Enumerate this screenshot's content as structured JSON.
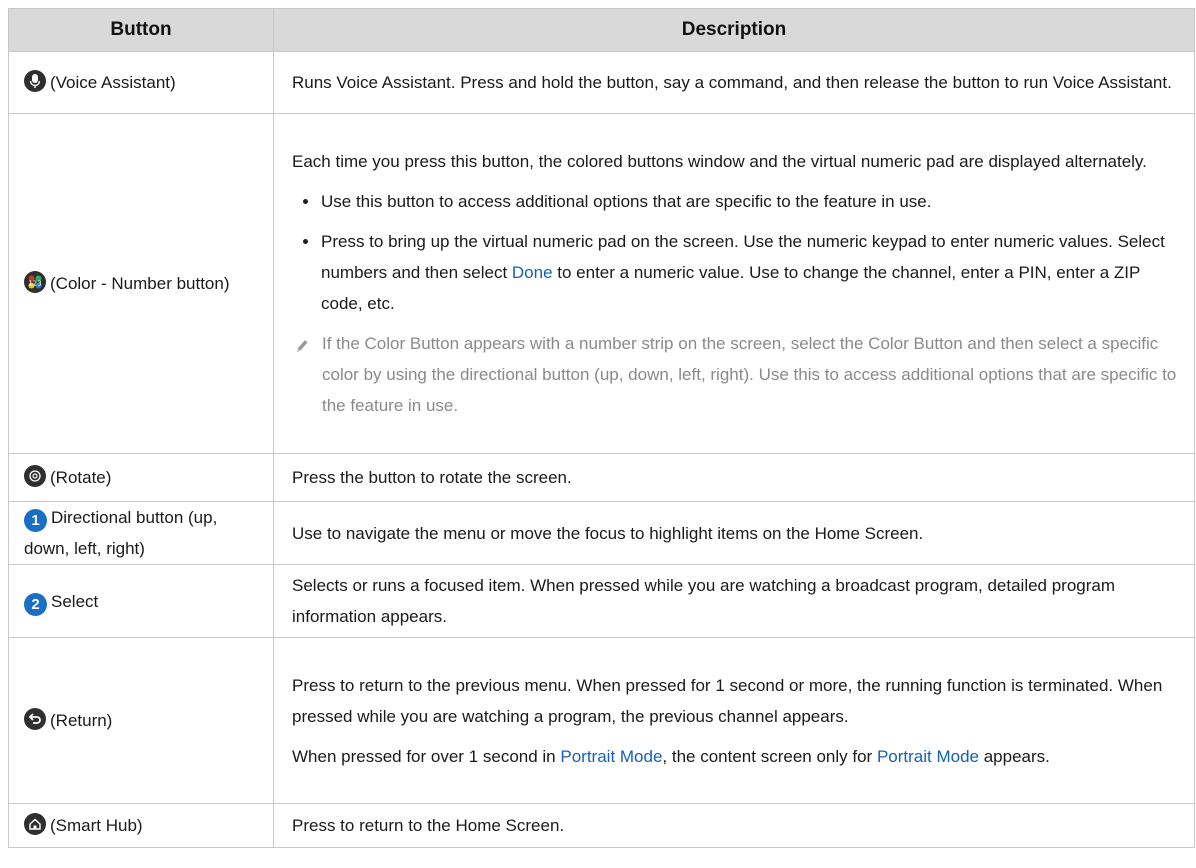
{
  "headers": {
    "button": "Button",
    "description": "Description"
  },
  "rows": {
    "voice": {
      "icon": "microphone-icon",
      "label": "(Voice Assistant)",
      "desc": "Runs Voice Assistant. Press and hold the button, say a command, and then release the button to run Voice Assistant."
    },
    "color": {
      "icon": "color-number-icon",
      "label": "(Color - Number button)",
      "intro": "Each time you press this button, the colored buttons window and the virtual numeric pad are displayed alternately.",
      "bullet1": "Use this button to access additional options that are specific to the feature in use.",
      "bullet2_a": "Press to bring up the virtual numeric pad on the screen. Use the numeric keypad to enter numeric values. Select numbers and then select ",
      "bullet2_link": "Done",
      "bullet2_b": " to enter a numeric value. Use to change the channel, enter a PIN, enter a ZIP code, etc.",
      "note": "If the Color Button appears with a number strip on the screen, select the Color Button and then select a specific color by using the directional button (up, down, left, right). Use this to access additional options that are specific to the feature in use."
    },
    "rotate": {
      "icon": "rotate-icon",
      "label": "(Rotate)",
      "desc": "Press the button to rotate the screen."
    },
    "directional": {
      "badge": "1",
      "label": "Directional button (up, down, left, right)",
      "desc": "Use to navigate the menu or move the focus to highlight items on the Home Screen."
    },
    "select": {
      "badge": "2",
      "label": "Select",
      "desc": "Selects or runs a focused item. When pressed while you are watching a broadcast program, detailed program information appears."
    },
    "return": {
      "icon": "return-icon",
      "label": "(Return)",
      "desc1": "Press to return to the previous menu. When pressed for 1 second or more, the running function is terminated. When pressed while you are watching a program, the previous channel appears.",
      "desc2_a": "When pressed for over 1 second in ",
      "desc2_link1": "Portrait Mode",
      "desc2_b": ", the content screen only for ",
      "desc2_link2": "Portrait Mode",
      "desc2_c": " appears."
    },
    "smarthub": {
      "icon": "home-icon",
      "label": "(Smart Hub)",
      "desc": "Press to return to the Home Screen."
    }
  },
  "colors": {
    "link": "#1660b3",
    "badge": "#1a6fc4",
    "header_bg": "#d9d9d9",
    "note_text": "#8a8a8a"
  }
}
